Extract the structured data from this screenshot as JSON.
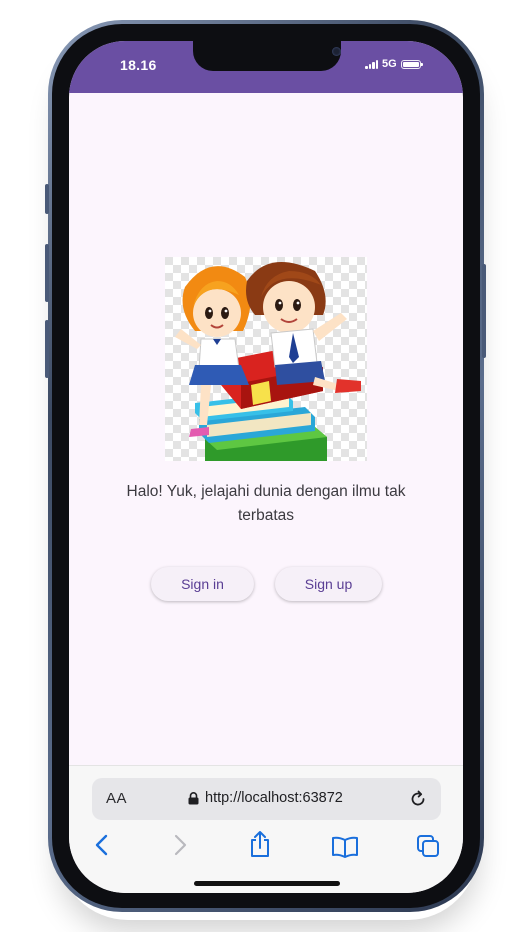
{
  "status_bar": {
    "time": "18.16",
    "network": "5G"
  },
  "main": {
    "illustration": "kids-on-books-image",
    "message": "Halo! Yuk, jelajahi dunia dengan ilmu tak terbatas",
    "sign_in_label": "Sign in",
    "sign_up_label": "Sign up"
  },
  "browser": {
    "reader_label": "AA",
    "url": "http://localhost:63872",
    "icons": [
      "back-icon",
      "forward-icon",
      "share-icon",
      "bookmarks-icon",
      "tabs-icon",
      "lock-icon",
      "reload-icon"
    ]
  },
  "colors": {
    "status_bar_bg": "#6a4fa3",
    "page_bg": "#fcf5fd",
    "button_text": "#5a3e94",
    "ios_blue": "#1a6fdc"
  }
}
